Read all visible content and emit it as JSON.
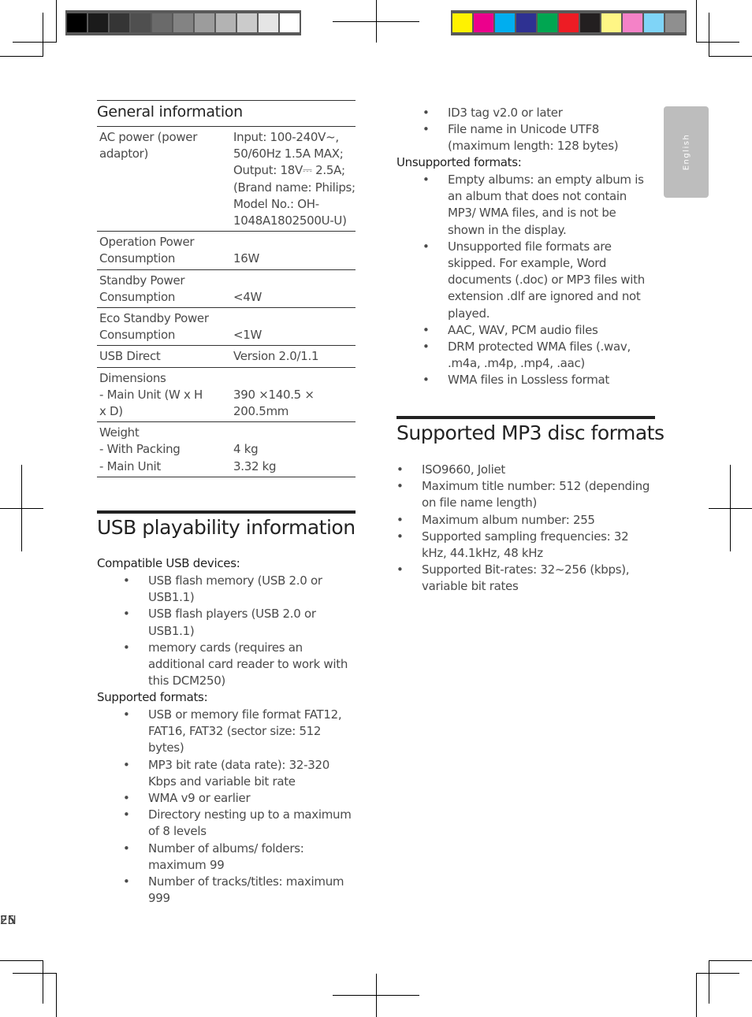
{
  "registration": {
    "gray_swatches": [
      "#000000",
      "#1b1b1b",
      "#353535",
      "#4f4f4f",
      "#6a6a6a",
      "#838383",
      "#9c9c9c",
      "#b3b3b3",
      "#cbcbcb",
      "#e5e5e5",
      "#ffffff"
    ],
    "color_swatches": [
      "#fff200",
      "#ec008c",
      "#00aeef",
      "#2e3192",
      "#00a651",
      "#ed1c24",
      "#231f20",
      "#fff685",
      "#f482c7",
      "#7fd4f7",
      "#8f8f8f"
    ]
  },
  "side_tab": {
    "label": "English"
  },
  "general_information": {
    "title": "General information",
    "rows": [
      {
        "key": "AC power (power adaptor)",
        "value": " Input: 100-240V~,\n50/60Hz 1.5A MAX;\nOutput: 18V⎓ 2.5A;\n(Brand name: Philips;\nModel No.: OH-\n1048A1802500U-U)"
      },
      {
        "key": "Operation Power\nConsumption",
        "value": "\n16W"
      },
      {
        "key": "Standby Power\nConsumption",
        "value": "\n<4W"
      },
      {
        "key": "Eco Standby Power\nConsumption",
        "value": "\n<1W"
      },
      {
        "key": "USB Direct",
        "value": "Version 2.0/1.1"
      },
      {
        "key": "Dimensions\n - Main Unit (W x H\n   x D)",
        "value": "\n390 ×140.5 ×\n200.5mm"
      },
      {
        "key": "Weight\n - With Packing\n - Main Unit",
        "value": "\n4 kg\n3.32 kg"
      }
    ]
  },
  "usb_playability": {
    "title": "USB playability information",
    "compatible_label": "Compatible USB devices:",
    "compatible_items": [
      "USB flash memory (USB 2.0 or USB1.1)",
      "USB flash players (USB 2.0 or USB1.1)",
      "memory cards (requires an additional card reader to work with this DCM250)"
    ],
    "supported_label": "Supported formats:",
    "supported_items": [
      "USB or memory file format FAT12, FAT16, FAT32 (sector size: 512 bytes)",
      "MP3 bit rate (data rate): 32-320 Kbps and variable bit rate",
      "WMA v9 or earlier",
      "Directory nesting up to a maximum of 8 levels",
      "Number of albums/ folders: maximum 99",
      "Number of tracks/titles: maximum 999",
      "ID3 tag v2.0 or later",
      "File name in Unicode UTF8 (maximum length: 128 bytes)"
    ],
    "unsupported_label": "Unsupported formats:",
    "unsupported_items": [
      "Empty albums: an empty album is an album that does not contain MP3/ WMA files, and is not be shown in the display.",
      "Unsupported file formats are skipped. For example, Word documents (.doc) or MP3 files with extension .dlf are ignored and not played.",
      "AAC, WAV, PCM audio files",
      "DRM protected WMA files (.wav, .m4a, .m4p, .mp4, .aac)",
      "WMA files in Lossless format"
    ]
  },
  "mp3_disc": {
    "title": "Supported MP3 disc formats",
    "items": [
      "ISO9660, Joliet",
      "Maximum title number: 512 (depending on file name length)",
      "Maximum album number: 255",
      "Supported sampling frequencies: 32 kHz, 44.1kHz, 48 kHz",
      "Supported Bit-rates: 32~256 (kbps), variable bit rates"
    ]
  },
  "footer": {
    "lang": "EN",
    "page": "25"
  },
  "bullet": "•"
}
